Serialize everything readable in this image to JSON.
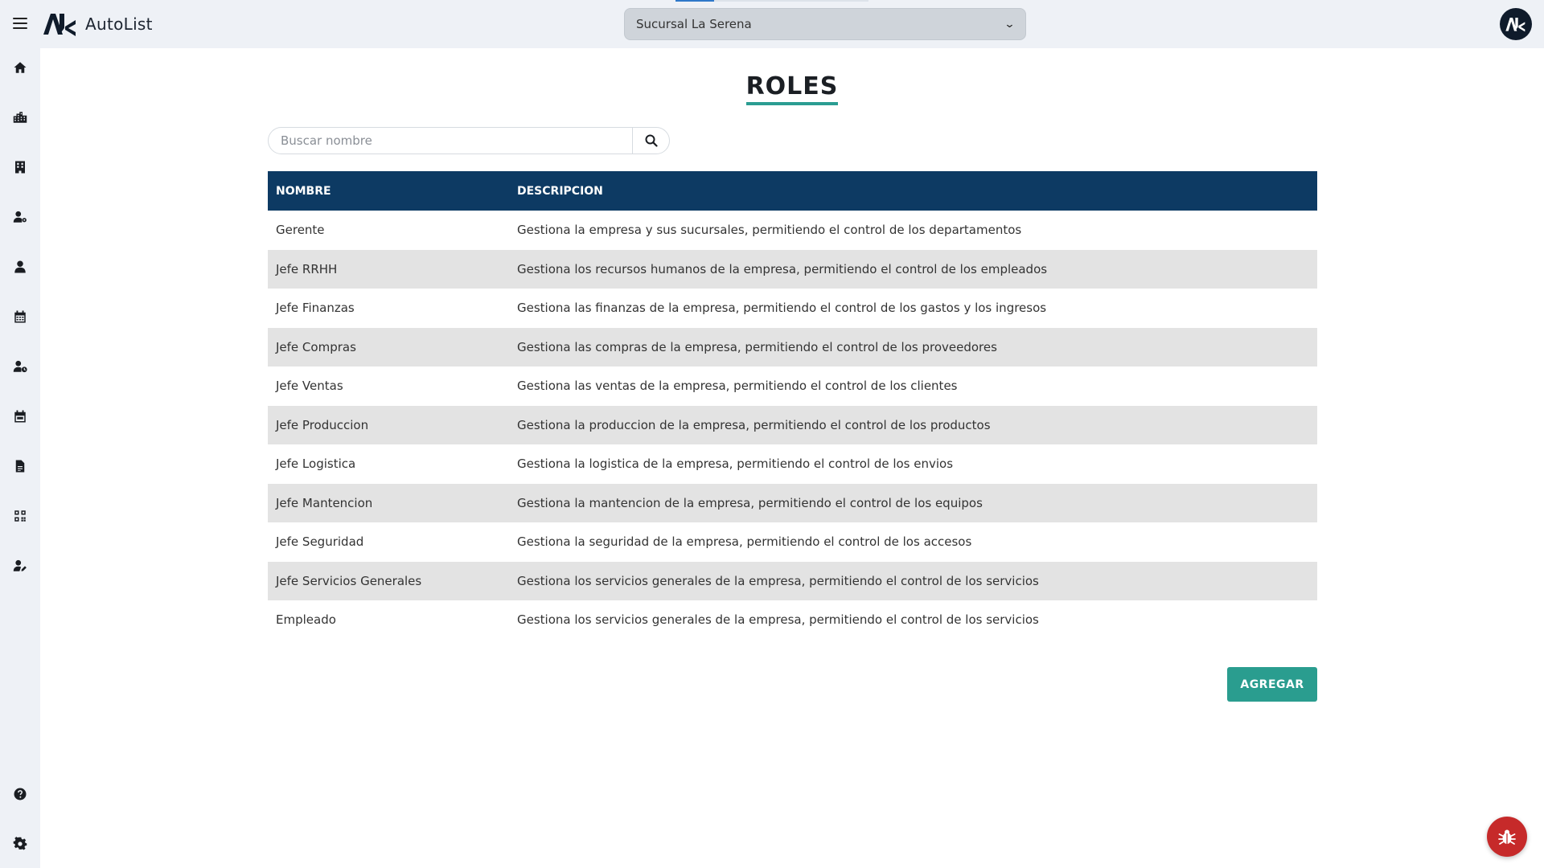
{
  "app": {
    "name": "AutoList",
    "logo_icon": "autolist-logo-icon"
  },
  "header": {
    "branch_select": {
      "value": "Sucursal La Serena"
    },
    "avatar_icon": "autolist-logo-icon"
  },
  "sidebar": {
    "items": [
      {
        "icon": "home-icon"
      },
      {
        "icon": "city-icon"
      },
      {
        "icon": "building-icon"
      },
      {
        "icon": "user-gear-icon"
      },
      {
        "icon": "user-icon"
      },
      {
        "icon": "calendar-icon"
      },
      {
        "icon": "user-clock-icon"
      },
      {
        "icon": "calendar-event-icon"
      },
      {
        "icon": "file-icon"
      },
      {
        "icon": "qrcode-icon"
      },
      {
        "icon": "user-pen-icon"
      }
    ],
    "bottom_items": [
      {
        "icon": "help-icon"
      },
      {
        "icon": "settings-icon"
      }
    ]
  },
  "page": {
    "title": "ROLES",
    "search": {
      "placeholder": "Buscar nombre",
      "value": ""
    },
    "table": {
      "headers": [
        "NOMBRE",
        "DESCRIPCION"
      ],
      "rows": [
        {
          "name": "Gerente",
          "description": "Gestiona la empresa y sus sucursales, permitiendo el control de los departamentos"
        },
        {
          "name": "Jefe RRHH",
          "description": "Gestiona los recursos humanos de la empresa, permitiendo el control de los empleados"
        },
        {
          "name": "Jefe Finanzas",
          "description": "Gestiona las finanzas de la empresa, permitiendo el control de los gastos y los ingresos"
        },
        {
          "name": "Jefe Compras",
          "description": "Gestiona las compras de la empresa, permitiendo el control de los proveedores"
        },
        {
          "name": "Jefe Ventas",
          "description": "Gestiona las ventas de la empresa, permitiendo el control de los clientes"
        },
        {
          "name": "Jefe Produccion",
          "description": "Gestiona la produccion de la empresa, permitiendo el control de los productos"
        },
        {
          "name": "Jefe Logistica",
          "description": "Gestiona la logistica de la empresa, permitiendo el control de los envios"
        },
        {
          "name": "Jefe Mantencion",
          "description": "Gestiona la mantencion de la empresa, permitiendo el control de los equipos"
        },
        {
          "name": "Jefe Seguridad",
          "description": "Gestiona la seguridad de la empresa, permitiendo el control de los accesos"
        },
        {
          "name": "Jefe Servicios Generales",
          "description": "Gestiona los servicios generales de la empresa, permitiendo el control de los servicios"
        },
        {
          "name": "Empleado",
          "description": "Gestiona los servicios generales de la empresa, permitiendo el control de los servicios"
        }
      ]
    },
    "add_button": "AGREGAR"
  },
  "floating": {
    "bug_icon": "bug-icon"
  },
  "colors": {
    "header_bg": "#0d3a63",
    "accent": "#2a9d8f",
    "bug_button": "#c62a2a",
    "row_alt": "#e3e3e3"
  }
}
